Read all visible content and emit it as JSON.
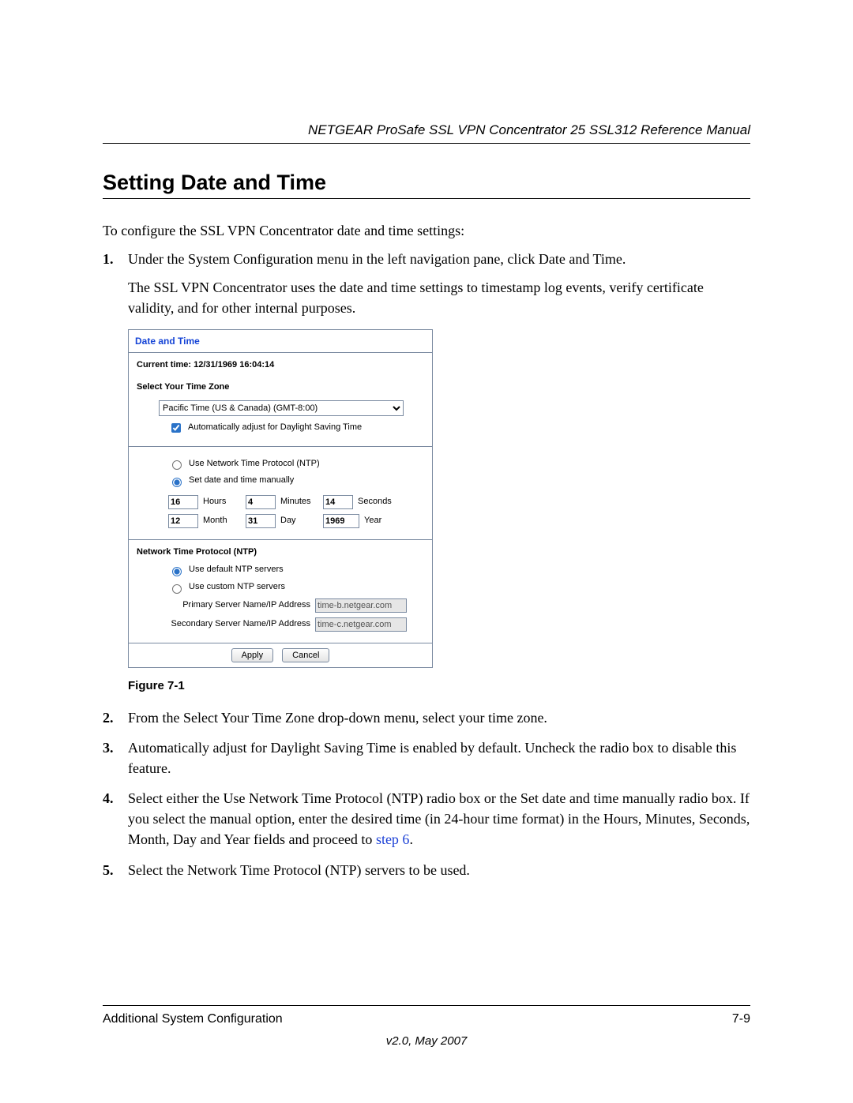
{
  "header": {
    "running": "NETGEAR ProSafe SSL VPN Concentrator 25 SSL312 Reference Manual"
  },
  "title": "Setting Date and Time",
  "intro": "To configure the SSL VPN Concentrator date and time settings:",
  "steps": [
    {
      "n": "1.",
      "text": "Under the System Configuration menu in the left navigation pane, click Date and Time.",
      "sub": "The SSL VPN Concentrator uses the date and time settings to timestamp log events, verify certificate validity, and for other internal purposes."
    },
    {
      "n": "2.",
      "text": "From the Select Your Time Zone drop-down menu, select your time zone."
    },
    {
      "n": "3.",
      "text": "Automatically adjust for Daylight Saving Time is enabled by default. Uncheck the radio box to disable this feature."
    },
    {
      "n": "4.",
      "text_a": "Select either the Use Network Time Protocol (NTP) radio box or the Set date and time manually radio box. If you select the manual option, enter the desired time (in 24-hour time format) in the Hours, Minutes, Seconds, Month, Day and Year fields and proceed to ",
      "link": "step 6",
      "text_b": "."
    },
    {
      "n": "5.",
      "text": "Select the Network Time Protocol (NTP) servers to be used."
    }
  ],
  "figure": {
    "caption": "Figure 7-1",
    "panel_title": "Date and Time",
    "current_time_label": "Current time: 12/31/1969 16:04:14",
    "tz_heading": "Select Your Time Zone",
    "tz_value": "Pacific Time (US & Canada) (GMT-8:00)",
    "dst_label": "Automatically adjust for Daylight Saving Time",
    "opt_ntp": "Use Network Time Protocol (NTP)",
    "opt_manual": "Set date and time manually",
    "time": {
      "hours": "16",
      "hours_lbl": "Hours",
      "minutes": "4",
      "minutes_lbl": "Minutes",
      "seconds": "14",
      "seconds_lbl": "Seconds",
      "month": "12",
      "month_lbl": "Month",
      "day": "31",
      "day_lbl": "Day",
      "year": "1969",
      "year_lbl": "Year"
    },
    "ntp_heading": "Network Time Protocol (NTP)",
    "ntp_default": "Use default NTP servers",
    "ntp_custom": "Use custom NTP servers",
    "primary_lbl": "Primary Server Name/IP Address",
    "primary_val": "time-b.netgear.com",
    "secondary_lbl": "Secondary Server Name/IP Address",
    "secondary_val": "time-c.netgear.com",
    "apply": "Apply",
    "cancel": "Cancel"
  },
  "footer": {
    "left": "Additional System Configuration",
    "right": "7-9",
    "version": "v2.0, May 2007"
  }
}
